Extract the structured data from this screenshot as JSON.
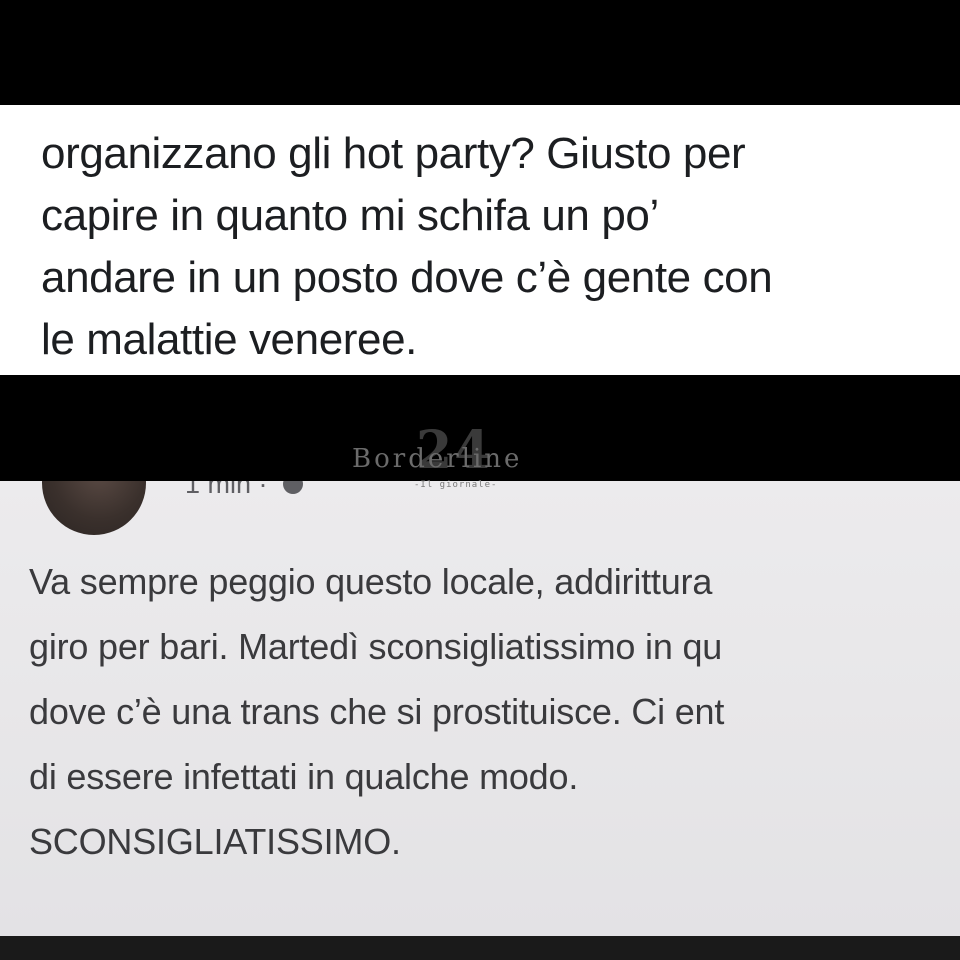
{
  "top_post": {
    "lines": [
      "organizzano gli hot party? Giusto per",
      "capire in quanto mi schifa un po’",
      "andare in un posto dove c’è gente con",
      "le malattie veneree."
    ]
  },
  "watermark": {
    "number": "24",
    "word": "Borderline",
    "subtitle": "-Il giornale-"
  },
  "bottom_post": {
    "timestamp": "1 min ·",
    "privacy_icon": "globe-icon",
    "lines": [
      "Va sempre peggio questo locale, addirittura",
      "giro per bari. Martedì sconsigliatissimo in qu",
      "dove c’è una trans che si prostituisce. Ci ent",
      "di essere infettati in qualche modo.",
      "SCONSIGLIATISSIMO."
    ]
  }
}
